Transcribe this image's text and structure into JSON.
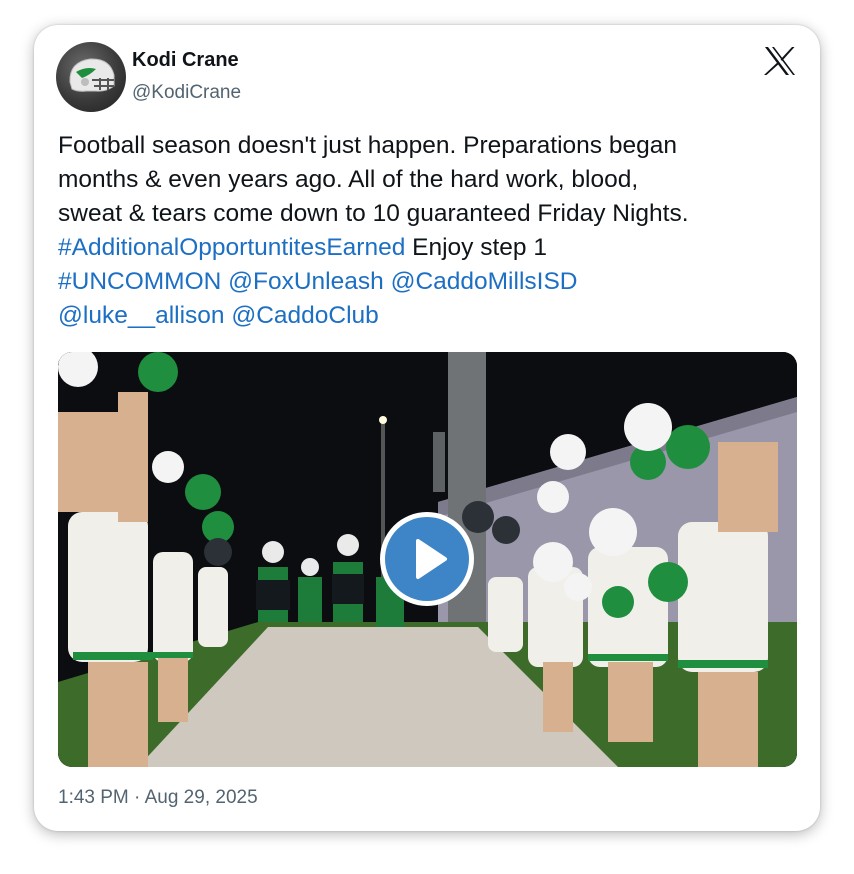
{
  "author": {
    "name": "Kodi Crane",
    "handle": "@KodiCrane",
    "avatar_icon": "football-helmet-icon"
  },
  "platform_icon": "x-logo-icon",
  "tweet": {
    "line1": "Football season doesn't just happen.  Preparations began",
    "line2": "months & even years ago. All of the hard work, blood,",
    "line3": "sweat & tears come down to 10 guaranteed Friday Nights.",
    "hashtag_earned": "#AdditionalOpportuntitesEarned",
    "enjoy_text": " Enjoy step 1",
    "hashtag_uncommon": "#UNCOMMON",
    "mention_fox": "@FoxUnleash",
    "mention_isd": "@CaddoMillsISD",
    "mention_luke": "@luke__allison",
    "mention_club": "@CaddoClub"
  },
  "media": {
    "type": "video",
    "play_icon": "play-icon"
  },
  "timestamp": "1:43 PM · Aug 29, 2025",
  "colors": {
    "link": "#1d6fc4",
    "play": "#3d85c6",
    "team_green": "#1f8f3f"
  }
}
